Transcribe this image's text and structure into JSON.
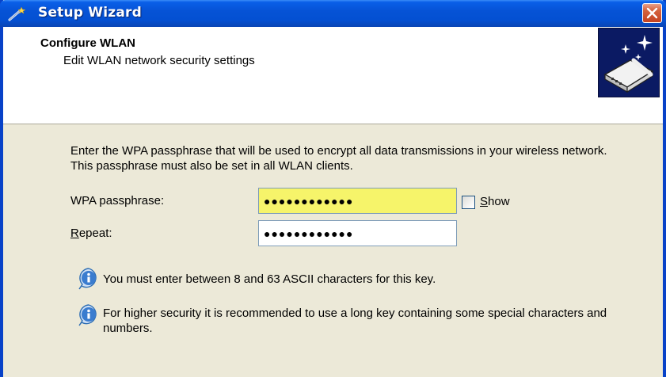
{
  "window": {
    "title": "Setup Wizard"
  },
  "header": {
    "title": "Configure WLAN",
    "subtitle": "Edit WLAN network security settings"
  },
  "body": {
    "intro": "Enter the WPA passphrase that will be used to encrypt all data transmissions in your wireless network. This passphrase must also be set in all WLAN clients.",
    "passphrase": {
      "label": "WPA passphrase:",
      "value": "●●●●●●●●●●●●"
    },
    "repeat": {
      "label_accel": "R",
      "label_rest": "epeat:",
      "value": "●●●●●●●●●●●●"
    },
    "show": {
      "label_accel": "S",
      "label_rest": "how",
      "checked": false
    },
    "info": [
      {
        "text": "You must enter between 8 and 63 ASCII characters for this key."
      },
      {
        "text": "For higher security it is recommended to use a long key containing some special characters and numbers."
      }
    ]
  },
  "colors": {
    "titlebar": "#0453d3",
    "dialog_bg": "#ece9d8",
    "focused_input": "#f6f46a",
    "info_icon": "#2c6db4"
  }
}
